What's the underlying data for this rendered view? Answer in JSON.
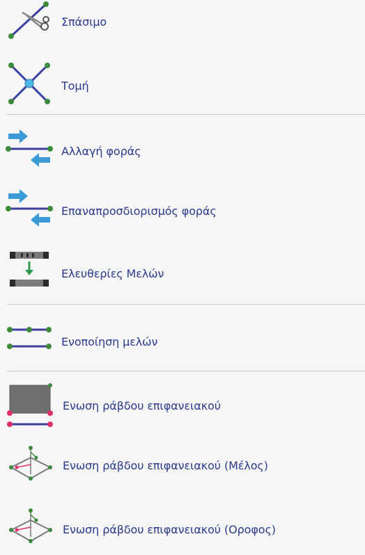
{
  "menu": {
    "items": [
      {
        "label": "Σπάσιμο",
        "icon": "split-scissors-icon"
      },
      {
        "label": "Τομή",
        "icon": "intersection-cross-icon"
      },
      {
        "label": "Αλλαγή φοράς",
        "icon": "change-direction-icon"
      },
      {
        "label": "Επαναπροσδιορισμός φοράς",
        "icon": "redefine-direction-icon"
      },
      {
        "label": "Ελευθερίες Μελών",
        "icon": "member-releases-icon"
      },
      {
        "label": "Ενοποίηση μελών",
        "icon": "merge-members-icon"
      },
      {
        "label": "Ενωση ράβδου επιφανειακού",
        "icon": "bar-surface-link-icon"
      },
      {
        "label": "Ενωση ράβδου επιφανειακού (Μέλος)",
        "icon": "bar-surface-link-member-icon"
      },
      {
        "label": "Ενωση ράβδου επιφανειακού (Οροφος)",
        "icon": "bar-surface-link-floor-icon"
      }
    ]
  },
  "colors": {
    "label_text": "#2a3a8c",
    "separator": "#c9c9c9",
    "background": "#f6f6f6",
    "node_green": "#3d8a3d",
    "line_blue": "#3b3fa0",
    "arrow_blue": "#3a9ad6",
    "pink_node": "#e0306a"
  }
}
